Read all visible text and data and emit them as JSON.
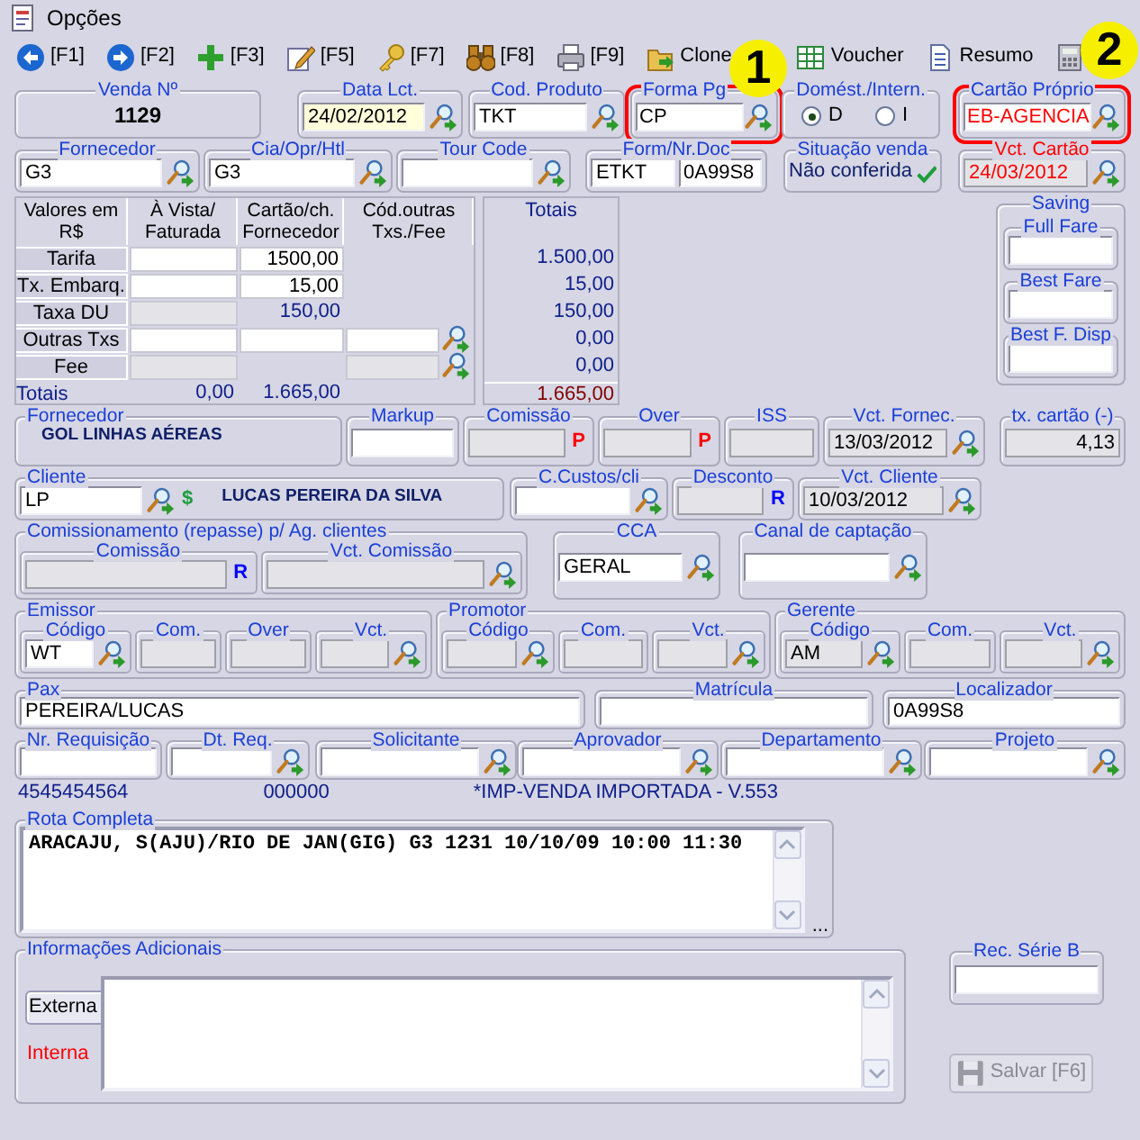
{
  "window": {
    "title": "Opções"
  },
  "toolbar": [
    {
      "kind": "back",
      "label": "[F1]"
    },
    {
      "kind": "forward",
      "label": "[F2]"
    },
    {
      "kind": "add",
      "label": "[F3]"
    },
    {
      "kind": "edit",
      "label": "[F5]"
    },
    {
      "kind": "key",
      "label": "[F7]"
    },
    {
      "kind": "binoculars",
      "label": "[F8]"
    },
    {
      "kind": "print",
      "label": "[F9]"
    },
    {
      "kind": "clone",
      "label": "Clone"
    },
    {
      "kind": "voucher",
      "label": "Voucher"
    },
    {
      "kind": "summary",
      "label": "Resumo"
    },
    {
      "kind": "calculator"
    }
  ],
  "callouts": [
    "1",
    "2"
  ],
  "header_rows": [
    [
      {
        "label": "Venda Nº",
        "items": [
          {
            "kind": "number",
            "value": "1129"
          }
        ]
      },
      {
        "label": "Data Lct.",
        "items": [
          {
            "kind": "input",
            "value": "24/02/2012",
            "focused": true
          },
          {
            "kind": "lookup"
          }
        ]
      },
      {
        "label": "Cod. Produto",
        "items": [
          {
            "kind": "input",
            "value": "TKT"
          },
          {
            "kind": "lookup"
          }
        ]
      },
      {
        "label": "Forma Pg",
        "highlighted": true,
        "items": [
          {
            "kind": "input",
            "value": "CP"
          },
          {
            "kind": "lookup"
          }
        ]
      },
      {
        "label": "Domést./Intern.",
        "items": [
          {
            "kind": "radio",
            "label": "D",
            "selected": true
          },
          {
            "kind": "radio",
            "label": "I",
            "selected": false
          }
        ]
      },
      {
        "label": "Cartão Próprio",
        "highlighted": true,
        "items": [
          {
            "kind": "input",
            "value": "EB-AGENCIA",
            "alert": true
          },
          {
            "kind": "lookup"
          }
        ]
      }
    ],
    [
      {
        "label": "Fornecedor",
        "items": [
          {
            "kind": "input",
            "value": "G3"
          },
          {
            "kind": "lookup"
          }
        ]
      },
      {
        "label": "Cia/Opr/Htl",
        "items": [
          {
            "kind": "input",
            "value": "G3"
          },
          {
            "kind": "lookup"
          }
        ]
      },
      {
        "label": "Tour Code",
        "items": [
          {
            "kind": "input"
          },
          {
            "kind": "lookup"
          }
        ]
      },
      {
        "label": "Form/Nr.Doc",
        "items": [
          {
            "kind": "input",
            "value": "ETKT"
          },
          {
            "kind": "input",
            "value": "0A99S8"
          }
        ]
      },
      {
        "label": "Situação venda",
        "items": [
          {
            "kind": "status",
            "value": "Não conferida"
          },
          {
            "kind": "check"
          }
        ]
      },
      {
        "label": "Vct. Cartão",
        "alert": true,
        "items": [
          {
            "kind": "readonly",
            "value": "24/03/2012",
            "alert": true
          },
          {
            "kind": "lookup"
          }
        ]
      }
    ]
  ],
  "values_table": {
    "columns": [
      "Valores em R$",
      "À Vista/ Faturada",
      "Cartão/ch. Fornecedor",
      "Cód.outras Txs./Fee",
      "Totais"
    ],
    "rows": [
      {
        "label": "Tarifa",
        "cells": [
          {
            "kind": "input"
          },
          {
            "kind": "input",
            "value": "1500,00"
          },
          {
            "kind": "blank"
          }
        ],
        "total": "1.500,00"
      },
      {
        "label": "Tx. Embarq.",
        "cells": [
          {
            "kind": "input"
          },
          {
            "kind": "input",
            "value": "15,00"
          },
          {
            "kind": "blank"
          }
        ],
        "total": "15,00"
      },
      {
        "label": "Taxa DU",
        "cells": [
          {
            "kind": "readonly"
          },
          {
            "kind": "amount",
            "value": "150,00"
          },
          {
            "kind": "blank"
          }
        ],
        "total": "150,00"
      },
      {
        "label": "Outras Txs",
        "cells": [
          {
            "kind": "input"
          },
          {
            "kind": "input"
          },
          {
            "kind": "input"
          },
          {
            "kind": "lookup"
          }
        ],
        "total": "0,00"
      },
      {
        "label": "Fee",
        "cells": [
          {
            "kind": "readonly"
          },
          {
            "kind": "blank"
          },
          {
            "kind": "readonly"
          },
          {
            "kind": "lookup"
          }
        ],
        "total": "0,00"
      }
    ],
    "footer": {
      "label": "Totais",
      "values": [
        "0,00",
        "1.665,00"
      ],
      "total": "1.665,00"
    }
  },
  "saving": {
    "label": "Saving",
    "groups": [
      {
        "label": "Full Fare",
        "items": [
          {
            "kind": "input"
          }
        ]
      },
      {
        "label": "Best Fare",
        "items": [
          {
            "kind": "input"
          }
        ]
      },
      {
        "label": "Best F. Disp",
        "items": [
          {
            "kind": "input"
          }
        ]
      }
    ]
  },
  "detail_rows": [
    [
      {
        "label": "Fornecedor",
        "items": [
          {
            "kind": "name",
            "value": "GOL LINHAS AÉREAS"
          }
        ]
      },
      {
        "label": "Markup",
        "items": [
          {
            "kind": "input"
          }
        ]
      },
      {
        "label": "Comissão",
        "items": [
          {
            "kind": "readonly"
          },
          {
            "kind": "flag",
            "value": "P",
            "color": "#ff0000"
          }
        ]
      },
      {
        "label": "Over",
        "items": [
          {
            "kind": "readonly"
          },
          {
            "kind": "flag",
            "value": "P",
            "color": "#ff0000"
          }
        ]
      },
      {
        "label": "ISS",
        "items": [
          {
            "kind": "readonly"
          }
        ]
      },
      {
        "label": "Vct. Fornec.",
        "items": [
          {
            "kind": "readonly",
            "value": "13/03/2012"
          },
          {
            "kind": "lookup"
          }
        ]
      },
      {
        "label": "tx. cartão (-)",
        "items": [
          {
            "kind": "readonly",
            "value": "4,13",
            "right_aligned": true
          }
        ]
      }
    ],
    [
      {
        "label": "Cliente",
        "items": [
          {
            "kind": "input",
            "value": "LP"
          },
          {
            "kind": "lookup"
          },
          {
            "kind": "flag",
            "value": "$",
            "color": "#1e9e3c"
          },
          {
            "kind": "name",
            "value": "LUCAS PEREIRA DA SILVA"
          }
        ]
      },
      {
        "label": "C.Custos/cli",
        "items": [
          {
            "kind": "input"
          },
          {
            "kind": "lookup"
          }
        ]
      },
      {
        "label": "Desconto",
        "items": [
          {
            "kind": "readonly"
          },
          {
            "kind": "flag",
            "value": "R",
            "color": "#0000ff"
          }
        ]
      },
      {
        "label": "Vct. Cliente",
        "items": [
          {
            "kind": "readonly",
            "value": "10/03/2012"
          },
          {
            "kind": "lookup"
          }
        ]
      }
    ],
    [
      {
        "label": "Comissionamento (repasse) p/ Ag. clientes",
        "groups": [
          {
            "label": "Comissão",
            "items": [
              {
                "kind": "readonly"
              },
              {
                "kind": "flag",
                "value": "R",
                "color": "#0000ff"
              }
            ]
          },
          {
            "label": "Vct. Comissão",
            "items": [
              {
                "kind": "readonly"
              },
              {
                "kind": "lookup"
              }
            ]
          }
        ]
      },
      {
        "label": "CCA",
        "items": [
          {
            "kind": "input",
            "value": "GERAL"
          },
          {
            "kind": "lookup"
          }
        ]
      },
      {
        "label": "Canal de captação",
        "items": [
          {
            "kind": "input"
          },
          {
            "kind": "lookup"
          }
        ]
      }
    ],
    [
      {
        "label": "Emissor",
        "groups": [
          {
            "label": "Código",
            "items": [
              {
                "kind": "input",
                "value": "WT"
              },
              {
                "kind": "lookup"
              }
            ]
          },
          {
            "label": "Com.",
            "items": [
              {
                "kind": "readonly"
              }
            ]
          },
          {
            "label": "Over",
            "items": [
              {
                "kind": "readonly"
              }
            ]
          },
          {
            "label": "Vct.",
            "items": [
              {
                "kind": "readonly"
              },
              {
                "kind": "lookup"
              }
            ]
          }
        ]
      },
      {
        "label": "Promotor",
        "groups": [
          {
            "label": "Código",
            "items": [
              {
                "kind": "readonly"
              },
              {
                "kind": "lookup"
              }
            ]
          },
          {
            "label": "Com.",
            "items": [
              {
                "kind": "readonly"
              }
            ]
          },
          {
            "label": "Vct.",
            "items": [
              {
                "kind": "readonly"
              },
              {
                "kind": "lookup"
              }
            ]
          }
        ]
      },
      {
        "label": "Gerente",
        "groups": [
          {
            "label": "Código",
            "items": [
              {
                "kind": "readonly",
                "value": "AM"
              },
              {
                "kind": "lookup"
              }
            ]
          },
          {
            "label": "Com.",
            "items": [
              {
                "kind": "readonly"
              }
            ]
          },
          {
            "label": "Vct.",
            "items": [
              {
                "kind": "readonly"
              },
              {
                "kind": "lookup"
              }
            ]
          }
        ]
      }
    ],
    [
      {
        "label": "Pax",
        "items": [
          {
            "kind": "input",
            "value": "PEREIRA/LUCAS"
          }
        ]
      },
      {
        "label": "Matrícula",
        "items": [
          {
            "kind": "input"
          }
        ]
      },
      {
        "label": "Localizador",
        "items": [
          {
            "kind": "input",
            "value": "0A99S8"
          }
        ]
      }
    ],
    [
      {
        "label": "Nr. Requisição",
        "items": [
          {
            "kind": "input"
          }
        ]
      },
      {
        "label": "Dt. Req.",
        "items": [
          {
            "kind": "input"
          },
          {
            "kind": "lookup"
          }
        ]
      },
      {
        "label": "Solicitante",
        "items": [
          {
            "kind": "input"
          },
          {
            "kind": "lookup"
          }
        ]
      },
      {
        "label": "Aprovador",
        "items": [
          {
            "kind": "input"
          },
          {
            "kind": "lookup"
          }
        ]
      },
      {
        "label": "Departamento",
        "items": [
          {
            "kind": "input"
          },
          {
            "kind": "lookup"
          }
        ]
      },
      {
        "label": "Projeto",
        "items": [
          {
            "kind": "input"
          },
          {
            "kind": "lookup"
          }
        ]
      }
    ]
  ],
  "info_line": [
    "4545454564",
    "000000",
    "*IMP-VENDA IMPORTADA - V.553"
  ],
  "rota": {
    "label": "Rota Completa",
    "text": "ARACAJU, S(AJU)/RIO DE JAN(GIG) G3 1231 10/10/09 10:00 11:30",
    "more": "..."
  },
  "informacoes": {
    "label": "Informações Adicionais",
    "tabs": [
      {
        "label": "Externa",
        "selected": true,
        "color": "#000000"
      },
      {
        "label": "Interna",
        "selected": false,
        "color": "#ff0000"
      }
    ]
  },
  "rec_serie_b": {
    "label": "Rec. Série B"
  },
  "save_button": {
    "label": "Salvar [F6]",
    "disabled": true
  }
}
